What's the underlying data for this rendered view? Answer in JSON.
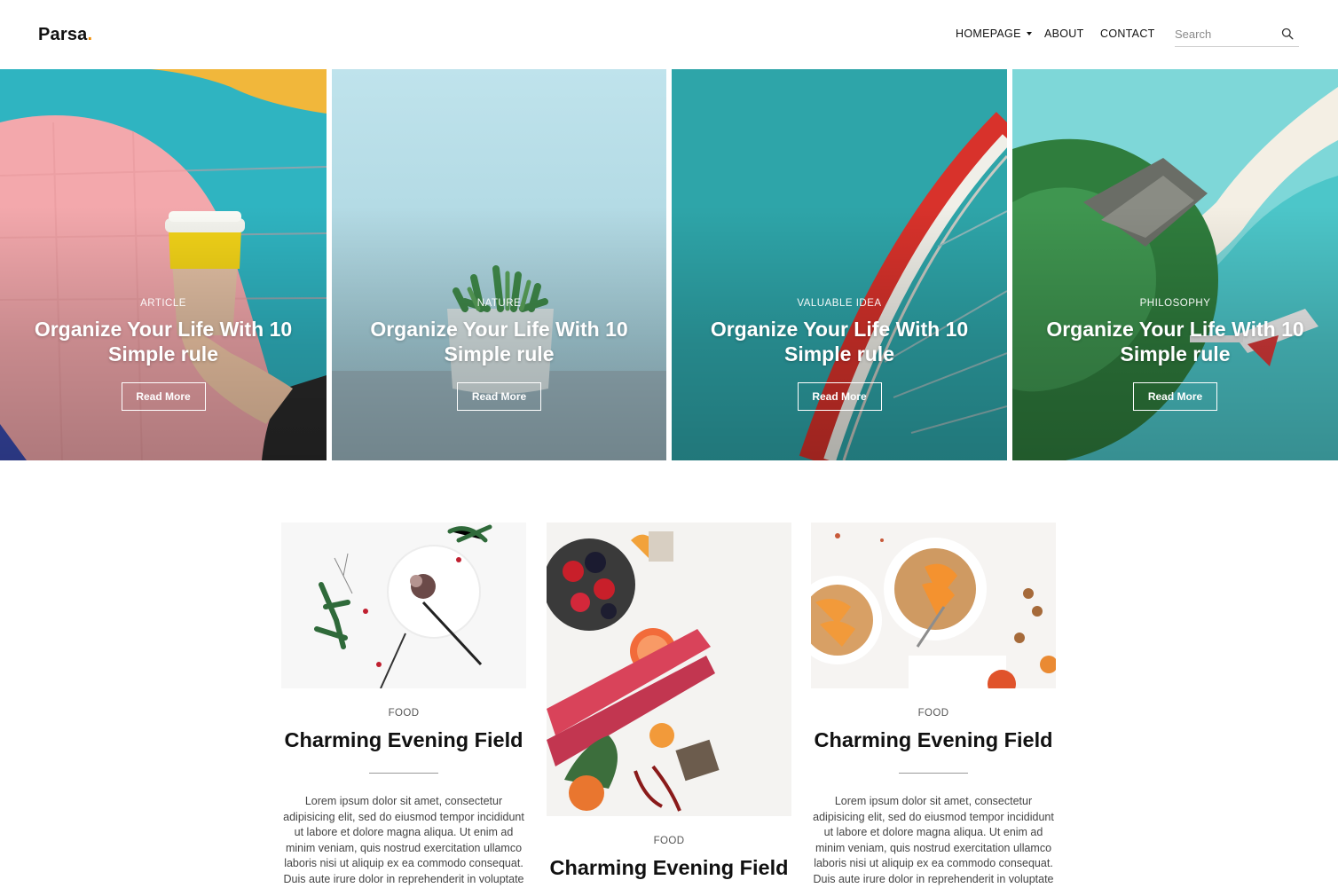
{
  "brand": {
    "name": "Parsa",
    "dot": "."
  },
  "nav": {
    "homepage": "HOMEPAGE",
    "about": "ABOUT",
    "contact": "CONTACT"
  },
  "search": {
    "placeholder": "Search"
  },
  "hero": [
    {
      "category": "ARTICLE",
      "title": "Organize Your Life With 10 Simple rule",
      "button": "Read More"
    },
    {
      "category": "NATURE",
      "title": "Organize Your Life With 10 Simple rule",
      "button": "Read More"
    },
    {
      "category": "VALUABLE IDEA",
      "title": "Organize Your Life With 10 Simple rule",
      "button": "Read More"
    },
    {
      "category": "PHILOSOPHY",
      "title": "Organize Your Life With 10 Simple rule",
      "button": "Read More"
    }
  ],
  "posts": [
    {
      "category": "FOOD",
      "title": "Charming Evening Field",
      "excerpt": "Lorem ipsum dolor sit amet, consectetur adipisicing elit, sed do eiusmod tempor incididunt ut labore et dolore magna aliqua. Ut enim ad minim veniam, quis nostrud exercitation ullamco laboris nisi ut aliquip ex ea commodo consequat. Duis aute irure dolor in reprehenderit in voluptate velit esse cillum dolore eu fugiat nulla"
    },
    {
      "category": "FOOD",
      "title": "Charming Evening Field"
    },
    {
      "category": "FOOD",
      "title": "Charming Evening Field",
      "excerpt": "Lorem ipsum dolor sit amet, consectetur adipisicing elit, sed do eiusmod tempor incididunt ut labore et dolore magna aliqua. Ut enim ad minim veniam, quis nostrud exercitation ullamco laboris nisi ut aliquip ex ea commodo consequat. Duis aute irure dolor in reprehenderit in voluptate velit esse cillum dolore eu fugiat nulla"
    }
  ],
  "colors": {
    "accent": "#f28c00",
    "text": "#111111",
    "muted": "#555555"
  }
}
